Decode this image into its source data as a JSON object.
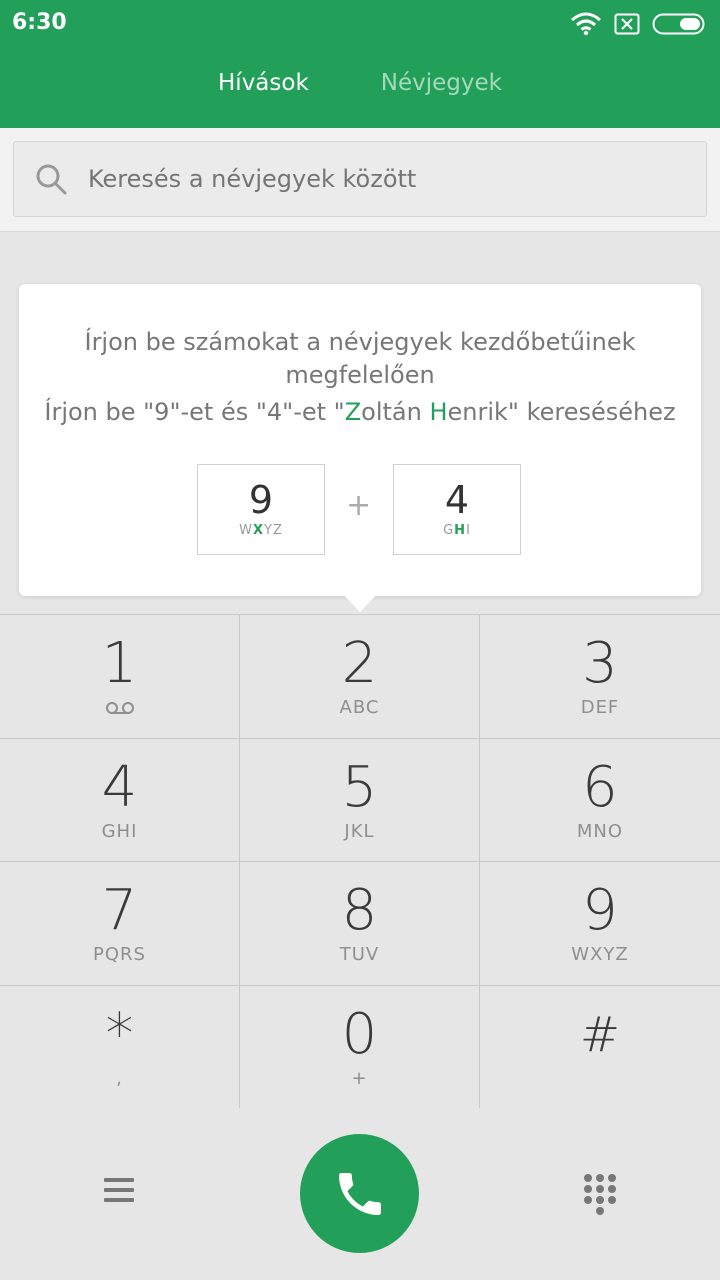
{
  "status_bar": {
    "time": "6:30"
  },
  "tabs": [
    {
      "label": "Hívások",
      "active": true
    },
    {
      "label": "Névjegyek",
      "active": false
    }
  ],
  "search": {
    "placeholder": "Keresés a névjegyek között"
  },
  "hint": {
    "line1": "Írjon be számokat a névjegyek kezdőbetűinek megfelelően",
    "line2_parts": [
      "Írjon be \"9\"-et és \"4\"-et \"",
      "Z",
      "oltán ",
      "H",
      "enrik\" kereséséhez"
    ],
    "example_keys": [
      {
        "digit": "9",
        "letters_pre": "W",
        "letters_hl": "X",
        "letters_post": "YZ"
      },
      {
        "digit": "4",
        "letters_pre": "G",
        "letters_hl": "H",
        "letters_post": "I"
      }
    ],
    "plus": "+"
  },
  "keypad": [
    {
      "digit": "1",
      "sub": "",
      "icon": "voicemail-icon"
    },
    {
      "digit": "2",
      "sub": "ABC"
    },
    {
      "digit": "3",
      "sub": "DEF"
    },
    {
      "digit": "4",
      "sub": "GHI"
    },
    {
      "digit": "5",
      "sub": "JKL"
    },
    {
      "digit": "6",
      "sub": "MNO"
    },
    {
      "digit": "7",
      "sub": "PQRS"
    },
    {
      "digit": "8",
      "sub": "TUV"
    },
    {
      "digit": "9",
      "sub": "WXYZ"
    },
    {
      "digit": "*",
      "sub": ","
    },
    {
      "digit": "0",
      "sub": "+"
    },
    {
      "digit": "#",
      "sub": ""
    }
  ],
  "bottom_bar": {
    "icons": [
      "menu-icon",
      "phone-icon",
      "dialpad-icon"
    ]
  },
  "colors": {
    "accent": "#22a05a",
    "background": "#e6e6e6"
  }
}
